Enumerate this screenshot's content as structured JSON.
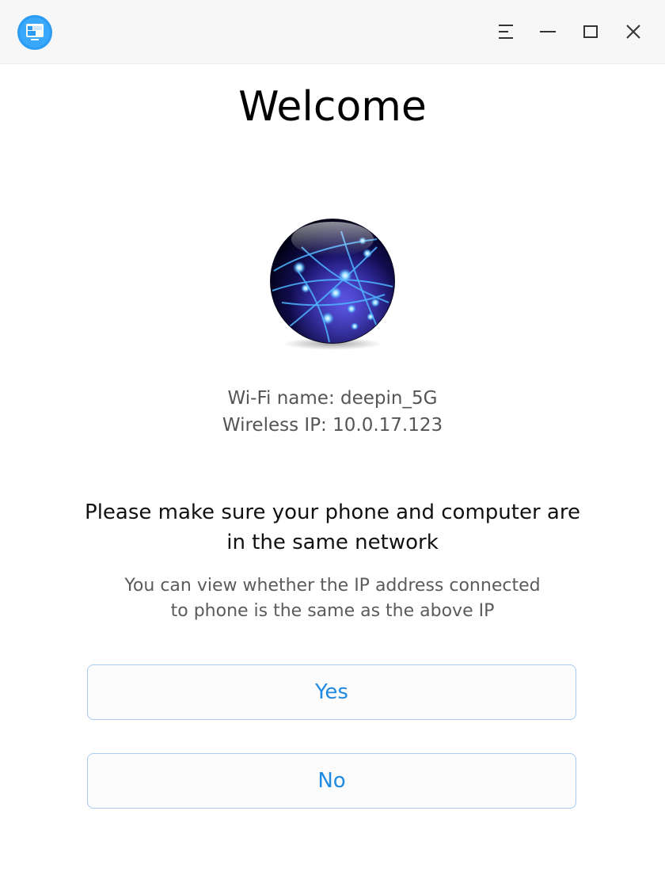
{
  "window": {
    "app_icon": "deepin-phone-assistant-icon",
    "controls": {
      "menu_icon": "menu-icon",
      "minimize_icon": "minimize-icon",
      "maximize_icon": "maximize-icon",
      "close_icon": "close-icon"
    }
  },
  "main": {
    "title": "Welcome",
    "illustration_icon": "network-globe-icon",
    "wifi_line": "Wi-Fi name: deepin_5G",
    "ip_line": "Wireless IP: 10.0.17.123",
    "headline_line1": "Please make sure your phone and computer are",
    "headline_line2": "in the same network",
    "subline_line1": "You can view whether the IP address connected",
    "subline_line2": "to phone is the same as the above IP",
    "yes_label": "Yes",
    "no_label": "No"
  },
  "colors": {
    "accent": "#1f8ae0",
    "button_border": "#a8caf0",
    "titlebar_bg": "#f7f7f7"
  }
}
